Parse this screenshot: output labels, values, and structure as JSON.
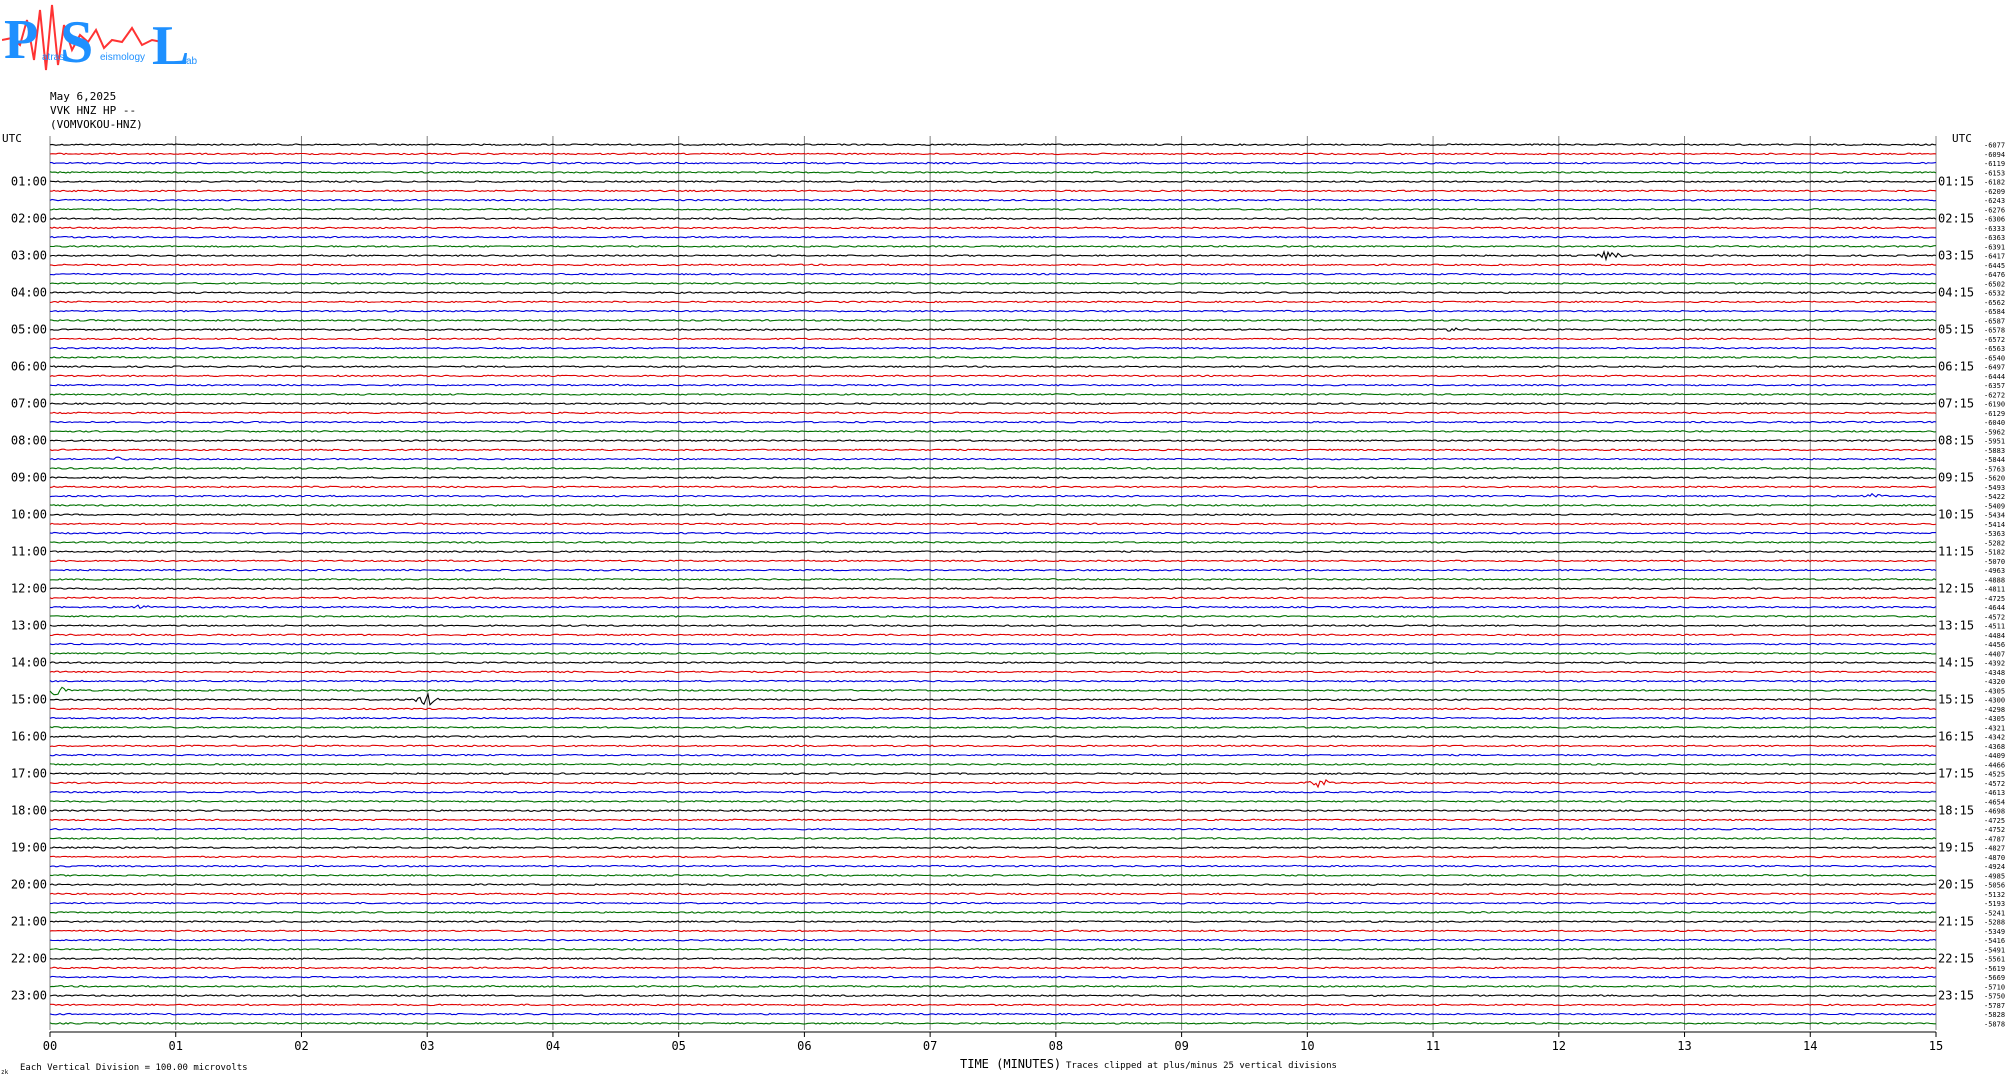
{
  "header": {
    "date": "May 6,2025",
    "station": "VVK HNZ HP --",
    "channel": "(VOMVOKOU-HNZ)"
  },
  "logo": {
    "letters": [
      "P",
      "S",
      "L"
    ],
    "words": [
      "atras",
      "eismology",
      "ab"
    ]
  },
  "footer": {
    "scale_note": "Each Vertical Division =  100.00 microvolts",
    "clip_note": "Traces clipped at plus/minus 25 vertical divisions",
    "corner_mark": "zk"
  },
  "colors": {
    "trace_cycle": [
      "#000000",
      "#e00000",
      "#0000dd",
      "#007000"
    ],
    "grid": "#808080",
    "logo_blue": "#1e90ff",
    "logo_red": "#ff3333"
  },
  "chart_data": {
    "type": "line",
    "title": "",
    "xlabel": "TIME (MINUTES)",
    "ylabel": "UTC",
    "right_label": "UTC",
    "x_ticks": [
      "00",
      "01",
      "02",
      "03",
      "04",
      "05",
      "06",
      "07",
      "08",
      "09",
      "10",
      "11",
      "12",
      "13",
      "14",
      "15"
    ],
    "xlim": [
      0,
      15
    ],
    "left_hour_labels": [
      "01:00",
      "02:00",
      "03:00",
      "04:00",
      "05:00",
      "06:00",
      "07:00",
      "08:00",
      "09:00",
      "10:00",
      "11:00",
      "12:00",
      "13:00",
      "14:00",
      "15:00",
      "16:00",
      "17:00",
      "18:00",
      "19:00",
      "20:00",
      "21:00",
      "22:00",
      "23:00"
    ],
    "right_hour_labels": [
      "01:15",
      "02:15",
      "03:15",
      "04:15",
      "05:15",
      "06:15",
      "07:15",
      "08:15",
      "09:15",
      "10:15",
      "11:15",
      "12:15",
      "13:15",
      "14:15",
      "15:15",
      "16:15",
      "17:15",
      "18:15",
      "19:15",
      "20:15",
      "21:15",
      "22:15",
      "23:15"
    ],
    "trace_count": 96,
    "trace_minutes": 15,
    "offsets": [
      "-6077",
      "-6094",
      "-6119",
      "-6153",
      "-6182",
      "-6209",
      "-6243",
      "-6276",
      "-6306",
      "-6333",
      "-6363",
      "-6391",
      "-6417",
      "-6445",
      "-6476",
      "-6502",
      "-6532",
      "-6562",
      "-6584",
      "-6587",
      "-6578",
      "-6572",
      "-6563",
      "-6540",
      "-6497",
      "-6444",
      "-6357",
      "-6272",
      "-6190",
      "-6129",
      "-6040",
      "-5962",
      "-5951",
      "-5883",
      "-5844",
      "-5763",
      "-5620",
      "-5493",
      "-5422",
      "-5409",
      "-5434",
      "-5414",
      "-5363",
      "-5282",
      "-5182",
      "-5070",
      "-4963",
      "-4888",
      "-4811",
      "-4725",
      "-4644",
      "-4572",
      "-4511",
      "-4484",
      "-4456",
      "-4407",
      "-4392",
      "-4348",
      "-4320",
      "-4305",
      "-4300",
      "-4298",
      "-4305",
      "-4321",
      "-4342",
      "-4368",
      "-4409",
      "-4466",
      "-4525",
      "-4572",
      "-4613",
      "-4654",
      "-4698",
      "-4725",
      "-4752",
      "-4787",
      "-4827",
      "-4870",
      "-4924",
      "-4985",
      "-5056",
      "-5132",
      "-5193",
      "-5241",
      "-5288",
      "-5349",
      "-5416",
      "-5491",
      "-5561",
      "-5619",
      "-5669",
      "-5710",
      "-5750",
      "-5787",
      "-5828",
      "-5878"
    ],
    "events": [
      {
        "trace": 12,
        "minute": 12.4,
        "amplitude": 5
      },
      {
        "trace": 20,
        "minute": 11.15,
        "amplitude": 2
      },
      {
        "trace": 34,
        "minute": 0.5,
        "amplitude": 2
      },
      {
        "trace": 38,
        "minute": 14.5,
        "amplitude": 2
      },
      {
        "trace": 50,
        "minute": 0.7,
        "amplitude": 2
      },
      {
        "trace": 59,
        "minute": 0.05,
        "amplitude": 6
      },
      {
        "trace": 60,
        "minute": 3.0,
        "amplitude": 6
      },
      {
        "trace": 69,
        "minute": 10.1,
        "amplitude": 4
      }
    ],
    "grid": true
  }
}
